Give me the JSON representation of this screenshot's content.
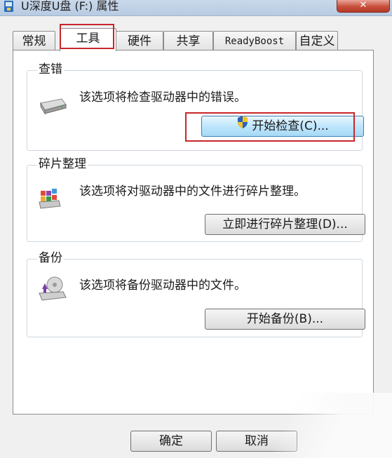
{
  "window": {
    "title": "U深度U盘 (F:) 属性",
    "close_label": "✕"
  },
  "tabs": [
    {
      "label": "常规",
      "active": false
    },
    {
      "label": "工具",
      "active": true
    },
    {
      "label": "硬件",
      "active": false
    },
    {
      "label": "共享",
      "active": false
    },
    {
      "label": "ReadyBoost",
      "active": false
    },
    {
      "label": "自定义",
      "active": false
    }
  ],
  "groups": {
    "error_check": {
      "title": "查错",
      "description": "该选项将检查驱动器中的错误。",
      "button_label": "开始检查(C)...",
      "icon": "drive-icon"
    },
    "defrag": {
      "title": "碎片整理",
      "description": "该选项将对驱动器中的文件进行碎片整理。",
      "button_label": "立即进行碎片整理(D)...",
      "icon": "defrag-icon"
    },
    "backup": {
      "title": "备份",
      "description": "该选项将备份驱动器中的文件。",
      "button_label": "开始备份(B)...",
      "icon": "backup-icon"
    }
  },
  "footer": {
    "ok_label": "确定",
    "cancel_label": "取消"
  },
  "colors": {
    "highlight": "#c8262a",
    "primary_button": "#bee6fd"
  }
}
